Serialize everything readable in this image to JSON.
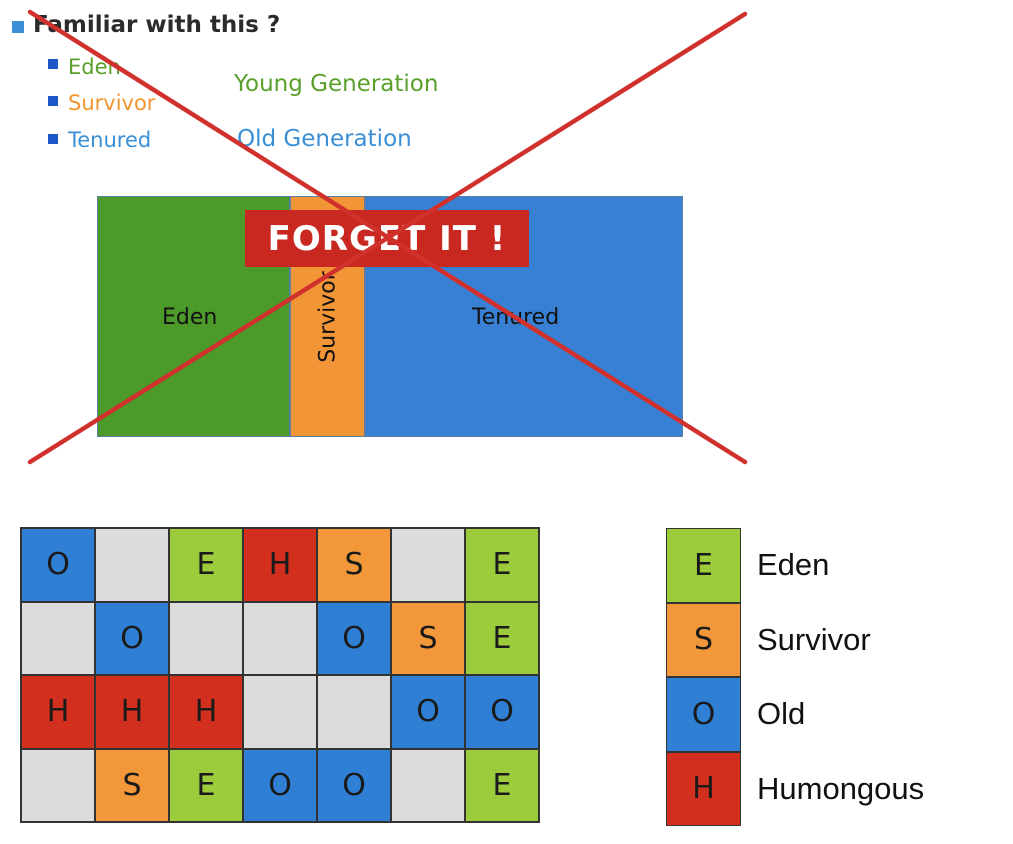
{
  "heading": "Familiar with this ?",
  "list": [
    {
      "label": "Eden",
      "color": "#5aa02c"
    },
    {
      "label": "Survivor",
      "color": "#f0962e"
    },
    {
      "label": "Tenured",
      "color": "#3a8fd6"
    }
  ],
  "generations": {
    "young": "Young Generation",
    "old": "Old Generation",
    "young_color": "#5aa02c",
    "old_color": "#3a8fd6"
  },
  "heap": {
    "eden_label": "Eden",
    "survivor_label": "Survivor",
    "tenured_label": "Tenured",
    "eden_color": "#4c9a2a",
    "survivor_color": "#f29536",
    "tenured_color": "#3880d4"
  },
  "banner": "FORGET IT !",
  "cross_color": "#d0312d",
  "region_colors": {
    "E": "#9ccc3c",
    "S": "#f2983a",
    "O": "#2f7fd4",
    "H": "#d32f1f",
    "empty": "#dcdcdc"
  },
  "grid": [
    [
      "O",
      "",
      "E",
      "H",
      "S",
      "",
      "E"
    ],
    [
      "",
      "O",
      "",
      "",
      "O",
      "S",
      "E"
    ],
    [
      "H",
      "H",
      "H",
      "",
      "",
      "O",
      "O"
    ],
    [
      "",
      "S",
      "E",
      "O",
      "O",
      "",
      "E"
    ]
  ],
  "legend": [
    {
      "key": "E",
      "label": "Eden"
    },
    {
      "key": "S",
      "label": "Survivor"
    },
    {
      "key": "O",
      "label": "Old"
    },
    {
      "key": "H",
      "label": "Humongous"
    }
  ]
}
